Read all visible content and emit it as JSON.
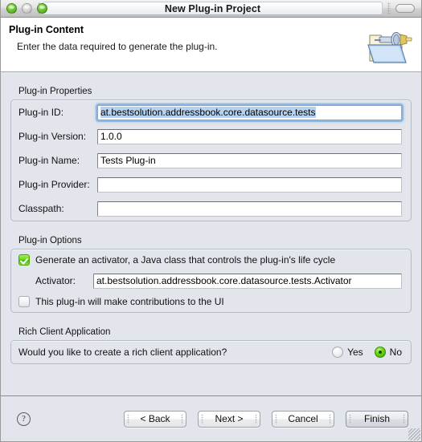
{
  "window": {
    "title": "New Plug-in Project",
    "controls": {
      "close": "close-button",
      "minimize": "minimize-button",
      "zoom": "zoom-button",
      "toolbar_toggle": "toolbar-toggle-button"
    }
  },
  "header": {
    "title": "Plug-in Content",
    "description": "Enter the data required to generate the plug-in.",
    "icon": "plug-in-project-icon"
  },
  "groups": {
    "properties": {
      "label": "Plug-in Properties",
      "fields": [
        {
          "label": "Plug-in ID:",
          "value": "at.bestsolution.addressbook.core.datasource.tests",
          "focused": true,
          "selected": true
        },
        {
          "label": "Plug-in Version:",
          "value": "1.0.0",
          "focused": false,
          "selected": false
        },
        {
          "label": "Plug-in Name:",
          "value": "Tests Plug-in",
          "focused": false,
          "selected": false
        },
        {
          "label": "Plug-in Provider:",
          "value": "",
          "focused": false,
          "selected": false
        },
        {
          "label": "Classpath:",
          "value": "",
          "focused": false,
          "selected": false
        }
      ]
    },
    "options": {
      "label": "Plug-in Options",
      "generate_activator": {
        "label": "Generate an activator, a Java class that controls the plug-in's life cycle",
        "checked": true
      },
      "activator": {
        "label": "Activator:",
        "value": "at.bestsolution.addressbook.core.datasource.tests.Activator"
      },
      "ui_contributions": {
        "label": "This plug-in will make contributions to the UI",
        "checked": false
      }
    },
    "rich_client": {
      "label": "Rich Client Application",
      "question": "Would you like to create a rich client application?",
      "options": [
        {
          "label": "Yes",
          "selected": false
        },
        {
          "label": "No",
          "selected": true
        }
      ]
    }
  },
  "footer": {
    "help": "?",
    "buttons": [
      {
        "label": "< Back",
        "default": false
      },
      {
        "label": "Next >",
        "default": false
      },
      {
        "label": "Cancel",
        "default": false
      },
      {
        "label": "Finish",
        "default": true
      }
    ]
  },
  "colors": {
    "accent_green": "#63d713",
    "focus_blue": "#7fa9d6",
    "selection_blue": "#b5d3f0",
    "window_bg": "#e2e5ec",
    "header_bg": "#ffffff"
  }
}
